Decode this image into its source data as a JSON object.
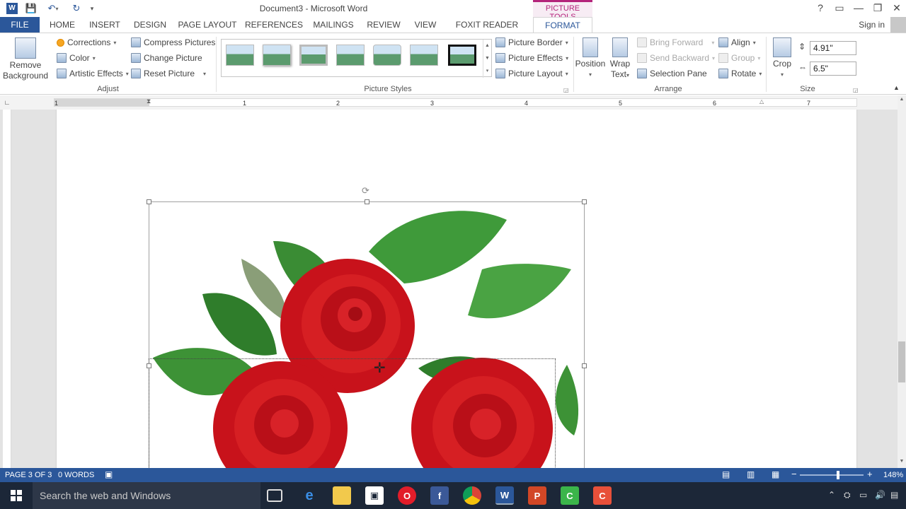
{
  "title_bar": {
    "document_title": "Document3 - Microsoft Word",
    "contextual_header": "PICTURE TOOLS",
    "window_controls": [
      "?",
      "▭",
      "—",
      "❐",
      "✕"
    ]
  },
  "tabs": [
    "FILE",
    "HOME",
    "INSERT",
    "DESIGN",
    "PAGE LAYOUT",
    "REFERENCES",
    "MAILINGS",
    "REVIEW",
    "VIEW",
    "FOXIT READER PDF",
    "FORMAT"
  ],
  "signin": "Sign in",
  "ribbon": {
    "adjust": {
      "remove_bg_line1": "Remove",
      "remove_bg_line2": "Background",
      "corrections": "Corrections",
      "color": "Color",
      "artistic_effects": "Artistic Effects",
      "compress": "Compress Pictures",
      "change": "Change Picture",
      "reset": "Reset Picture",
      "group_label": "Adjust"
    },
    "picture_styles": {
      "border": "Picture Border",
      "effects": "Picture Effects",
      "layout": "Picture Layout",
      "group_label": "Picture Styles"
    },
    "arrange": {
      "position": "Position",
      "wrap_line1": "Wrap",
      "wrap_line2": "Text",
      "bring_forward": "Bring Forward",
      "send_backward": "Send Backward",
      "selection_pane": "Selection Pane",
      "align": "Align",
      "group": "Group",
      "rotate": "Rotate",
      "group_label": "Arrange"
    },
    "size": {
      "crop": "Crop",
      "height": "4.91\"",
      "width": "6.5\"",
      "group_label": "Size"
    }
  },
  "ruler_numbers": [
    "1",
    "1",
    "2",
    "3",
    "4",
    "5",
    "6",
    "7"
  ],
  "status": {
    "page": "PAGE 3 OF 3",
    "words": "0 WORDS",
    "zoom": "148%",
    "zoom_level": 0.6
  },
  "taskbar": {
    "search_placeholder": "Search the web and Windows"
  },
  "colors": {
    "word_blue": "#2b579a",
    "picture_tools_accent": "#b4247b",
    "taskbar": "#1c2738"
  }
}
